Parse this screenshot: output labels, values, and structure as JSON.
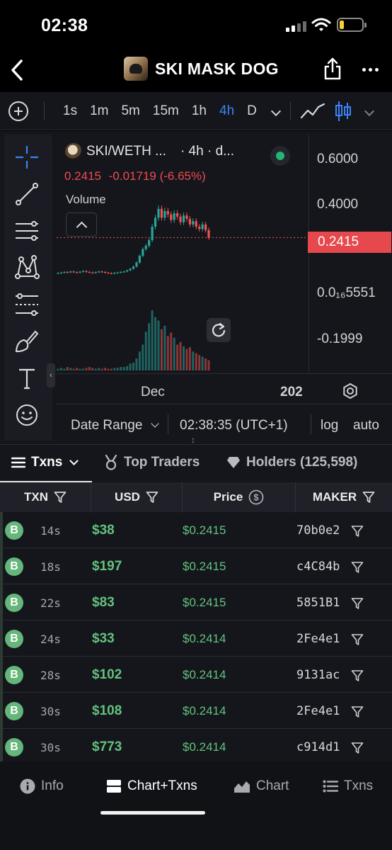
{
  "status_bar": {
    "time": "02:38"
  },
  "header": {
    "title": "SKI MASK DOG"
  },
  "toolbar": {
    "intervals": [
      {
        "label": "1s",
        "active": false
      },
      {
        "label": "1m",
        "active": false
      },
      {
        "label": "5m",
        "active": false
      },
      {
        "label": "15m",
        "active": false
      },
      {
        "label": "1h",
        "active": false
      },
      {
        "label": "4h",
        "active": true
      },
      {
        "label": "D",
        "active": false
      }
    ],
    "accent_color": "#3b82f6"
  },
  "chart": {
    "pair": "SKI/WETH ...",
    "timeframe": "· 4h · d...",
    "price": "0.2415",
    "change": "-0.01719 (-6.65%)",
    "volume_label": "Volume",
    "current_price_tag": "0.2415",
    "y_labels": [
      "0.6000",
      "0.4000",
      "0.2000",
      "0.0₁₆5551",
      "-0.1999"
    ],
    "x_labels": [
      "Dec",
      "202"
    ],
    "date_range_label": "Date Range",
    "clock": "02:38:35 (UTC+1)",
    "log_label": "log",
    "auto_label": "auto",
    "up_color": "#26a69a",
    "down_color": "#ef5350"
  },
  "chart_data": {
    "type": "candlestick",
    "title": "SKI/WETH",
    "x_tick_labels": [
      "Dec",
      "202"
    ],
    "y_tick_labels": [
      "0.6000",
      "0.4000",
      "0.2000",
      "0.0₁₆5551",
      "-0.1999"
    ],
    "ylim": [
      -0.1999,
      0.6
    ],
    "last_price": 0.2415,
    "price_series": [
      0.083,
      0.085,
      0.088,
      0.086,
      0.09,
      0.087,
      0.085,
      0.089,
      0.092,
      0.088,
      0.086,
      0.084,
      0.087,
      0.09,
      0.088,
      0.085,
      0.083,
      0.081,
      0.084,
      0.086,
      0.088,
      0.09,
      0.095,
      0.102,
      0.112,
      0.13,
      0.16,
      0.19,
      0.205,
      0.23,
      0.29,
      0.33,
      0.37,
      0.33,
      0.36,
      0.345,
      0.32,
      0.35,
      0.335,
      0.31,
      0.34,
      0.325,
      0.3,
      0.315,
      0.29,
      0.28,
      0.3,
      0.275,
      0.2415
    ],
    "volume_series": [
      2,
      3,
      2,
      4,
      3,
      2,
      3,
      2,
      2,
      3,
      4,
      3,
      2,
      3,
      2,
      3,
      2,
      2,
      3,
      3,
      4,
      4,
      5,
      8,
      9,
      14,
      22,
      30,
      45,
      55,
      70,
      62,
      58,
      48,
      52,
      40,
      44,
      38,
      30,
      33,
      28,
      25,
      27,
      22,
      20,
      18,
      16,
      14,
      12
    ]
  },
  "tabs": [
    {
      "label": "Txns",
      "active": true
    },
    {
      "label": "Top Traders",
      "active": false
    },
    {
      "label": "Holders (125,598)",
      "active": false
    }
  ],
  "table": {
    "headers": [
      "TXN",
      "USD",
      "Price",
      "MAKER"
    ],
    "rows": [
      {
        "type": "B",
        "age": "14s",
        "usd": "$38",
        "price": "$0.2415",
        "maker": "70b0e2"
      },
      {
        "type": "B",
        "age": "18s",
        "usd": "$197",
        "price": "$0.2415",
        "maker": "c4C84b"
      },
      {
        "type": "B",
        "age": "22s",
        "usd": "$83",
        "price": "$0.2415",
        "maker": "5851B1"
      },
      {
        "type": "B",
        "age": "24s",
        "usd": "$33",
        "price": "$0.2414",
        "maker": "2Fe4e1"
      },
      {
        "type": "B",
        "age": "28s",
        "usd": "$102",
        "price": "$0.2414",
        "maker": "9131ac"
      },
      {
        "type": "B",
        "age": "30s",
        "usd": "$108",
        "price": "$0.2414",
        "maker": "2Fe4e1"
      },
      {
        "type": "B",
        "age": "30s",
        "usd": "$773",
        "price": "$0.2414",
        "maker": "c914d1"
      }
    ],
    "buy_color": "#63c27d"
  },
  "bottom_nav": [
    {
      "label": "Info",
      "icon": "info-icon",
      "active": false
    },
    {
      "label": "Chart+Txns",
      "icon": "chart-txns-icon",
      "active": true
    },
    {
      "label": "Chart",
      "icon": "area-chart-icon",
      "active": false
    },
    {
      "label": "Txns",
      "icon": "list-icon",
      "active": false
    }
  ]
}
